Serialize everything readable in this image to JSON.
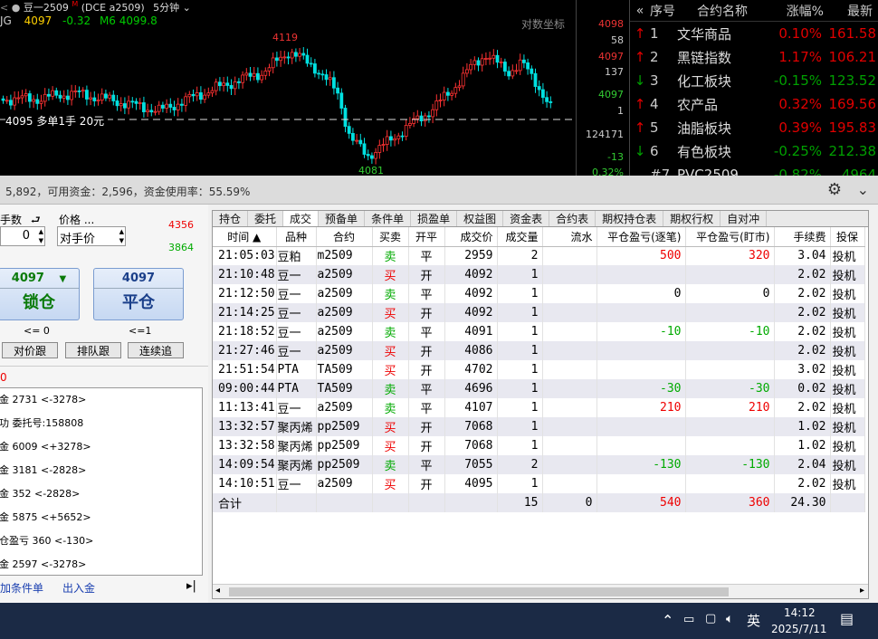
{
  "chart": {
    "symbol": "豆一2509",
    "exchange": "(DCE  a2509)",
    "period": "5分钟",
    "ma_label": "JG",
    "ma_price": "4097",
    "ma_change": "-0.32",
    "ma6": "M6 4099.8",
    "log_label": "对数坐标",
    "high_label": "4119",
    "low_label": "4081",
    "position_line": "4095 多单1手 20元",
    "axis": [
      "4098",
      "58",
      "4097",
      "137",
      "4097",
      "1",
      "124171",
      "-13",
      "0.32%"
    ]
  },
  "plist": {
    "headers": [
      "序号",
      "合约名称",
      "涨幅%",
      "最新"
    ],
    "rows": [
      {
        "idx": "1",
        "arrow": "up",
        "name": "文华商品",
        "chg": "0.10%",
        "last": "161.58",
        "chg_color": "red"
      },
      {
        "idx": "2",
        "arrow": "up",
        "name": "黑链指数",
        "chg": "1.17%",
        "last": "106.21",
        "chg_color": "red"
      },
      {
        "idx": "3",
        "arrow": "down",
        "name": "化工板块",
        "chg": "-0.15%",
        "last": "123.52",
        "chg_color": "green"
      },
      {
        "idx": "4",
        "arrow": "up",
        "name": "农产品",
        "chg": "0.32%",
        "last": "169.56",
        "chg_color": "red"
      },
      {
        "idx": "5",
        "arrow": "up",
        "name": "油脂板块",
        "chg": "0.39%",
        "last": "195.83",
        "chg_color": "red"
      },
      {
        "idx": "6",
        "arrow": "down",
        "name": "有色板块",
        "chg": "-0.25%",
        "last": "212.38",
        "chg_color": "green"
      },
      {
        "idx": "#7",
        "arrow": "",
        "name": "PVC2509",
        "chg": "-0.82%",
        "last": "4964",
        "chg_color": "green"
      }
    ]
  },
  "topbar": {
    "text": "5,892，可用资金：2,596，资金使用率：55.59%"
  },
  "order": {
    "qty_label": "手数",
    "qty_value": "0",
    "price_label": "价格 ...",
    "price_value": "对手价",
    "ask": "4356",
    "bid": "3864",
    "lock_price": "4097",
    "lock_label": "锁仓",
    "close_price": "4097",
    "close_label": "平仓",
    "lock_sub": "<= 0",
    "close_sub": "<=1",
    "btn1": "对价跟",
    "btn2": "排队跟",
    "btn3": "连续追",
    "zero": "0"
  },
  "log": [
    "金 2731 <-3278>",
    "功 委托号:158808",
    "金 6009 <+3278>",
    "金 3181 <-2828>",
    "金 352 <-2828>",
    "金 5875 <+5652>",
    "仓盈亏 360 <-130>",
    "金 2597 <-3278>"
  ],
  "left_footer": {
    "cond": "加条件单",
    "inout": "出入金"
  },
  "tabs": [
    "持仓",
    "委托",
    "成交",
    "预备单",
    "条件单",
    "损盈单",
    "权益图",
    "资金表",
    "合约表",
    "期权持仓表",
    "期权行权",
    "自对冲"
  ],
  "active_tab": "成交",
  "table": {
    "headers": [
      "时间 ▲",
      "品种",
      "合约",
      "买卖",
      "开平",
      "成交价",
      "成交量",
      "流水",
      "平仓盈亏(逐笔)",
      "平仓盈亏(盯市)",
      "手续费",
      "投保"
    ],
    "rows": [
      {
        "time": "21:05:03",
        "prod": "豆粕",
        "contract": "m2509",
        "side": "卖",
        "oc": "平",
        "price": "2959",
        "vol": "2",
        "flow": "",
        "pnl1": "500",
        "pnl2": "320",
        "fee": "3.04",
        "hedge": "投机"
      },
      {
        "time": "21:10:48",
        "prod": "豆一",
        "contract": "a2509",
        "side": "买",
        "oc": "开",
        "price": "4092",
        "vol": "1",
        "flow": "",
        "pnl1": "",
        "pnl2": "",
        "fee": "2.02",
        "hedge": "投机"
      },
      {
        "time": "21:12:50",
        "prod": "豆一",
        "contract": "a2509",
        "side": "卖",
        "oc": "平",
        "price": "4092",
        "vol": "1",
        "flow": "",
        "pnl1": "0",
        "pnl2": "0",
        "fee": "2.02",
        "hedge": "投机"
      },
      {
        "time": "21:14:25",
        "prod": "豆一",
        "contract": "a2509",
        "side": "买",
        "oc": "开",
        "price": "4092",
        "vol": "1",
        "flow": "",
        "pnl1": "",
        "pnl2": "",
        "fee": "2.02",
        "hedge": "投机"
      },
      {
        "time": "21:18:52",
        "prod": "豆一",
        "contract": "a2509",
        "side": "卖",
        "oc": "平",
        "price": "4091",
        "vol": "1",
        "flow": "",
        "pnl1": "-10",
        "pnl2": "-10",
        "fee": "2.02",
        "hedge": "投机"
      },
      {
        "time": "21:27:46",
        "prod": "豆一",
        "contract": "a2509",
        "side": "买",
        "oc": "开",
        "price": "4086",
        "vol": "1",
        "flow": "",
        "pnl1": "",
        "pnl2": "",
        "fee": "2.02",
        "hedge": "投机"
      },
      {
        "time": "21:51:54",
        "prod": "PTA",
        "contract": "TA509",
        "side": "买",
        "oc": "开",
        "price": "4702",
        "vol": "1",
        "flow": "",
        "pnl1": "",
        "pnl2": "",
        "fee": "3.02",
        "hedge": "投机"
      },
      {
        "time": "09:00:44",
        "prod": "PTA",
        "contract": "TA509",
        "side": "卖",
        "oc": "平",
        "price": "4696",
        "vol": "1",
        "flow": "",
        "pnl1": "-30",
        "pnl2": "-30",
        "fee": "0.02",
        "hedge": "投机"
      },
      {
        "time": "11:13:41",
        "prod": "豆一",
        "contract": "a2509",
        "side": "卖",
        "oc": "平",
        "price": "4107",
        "vol": "1",
        "flow": "",
        "pnl1": "210",
        "pnl2": "210",
        "fee": "2.02",
        "hedge": "投机"
      },
      {
        "time": "13:32:57",
        "prod": "聚丙烯",
        "contract": "pp2509",
        "side": "买",
        "oc": "开",
        "price": "7068",
        "vol": "1",
        "flow": "",
        "pnl1": "",
        "pnl2": "",
        "fee": "1.02",
        "hedge": "投机"
      },
      {
        "time": "13:32:58",
        "prod": "聚丙烯",
        "contract": "pp2509",
        "side": "买",
        "oc": "开",
        "price": "7068",
        "vol": "1",
        "flow": "",
        "pnl1": "",
        "pnl2": "",
        "fee": "1.02",
        "hedge": "投机"
      },
      {
        "time": "14:09:54",
        "prod": "聚丙烯",
        "contract": "pp2509",
        "side": "卖",
        "oc": "平",
        "price": "7055",
        "vol": "2",
        "flow": "",
        "pnl1": "-130",
        "pnl2": "-130",
        "fee": "2.04",
        "hedge": "投机"
      },
      {
        "time": "14:10:51",
        "prod": "豆一",
        "contract": "a2509",
        "side": "买",
        "oc": "开",
        "price": "4095",
        "vol": "1",
        "flow": "",
        "pnl1": "",
        "pnl2": "",
        "fee": "2.02",
        "hedge": "投机"
      }
    ],
    "total": {
      "label": "合计",
      "vol": "15",
      "flow": "0",
      "pnl1": "540",
      "pnl2": "360",
      "fee": "24.30"
    }
  },
  "taskbar": {
    "ime": "英",
    "time": "14:12",
    "date": "2025/7/11"
  },
  "colors": {
    "up": "#e00000",
    "down": "#00a000",
    "accent": "#1a4fa0"
  }
}
